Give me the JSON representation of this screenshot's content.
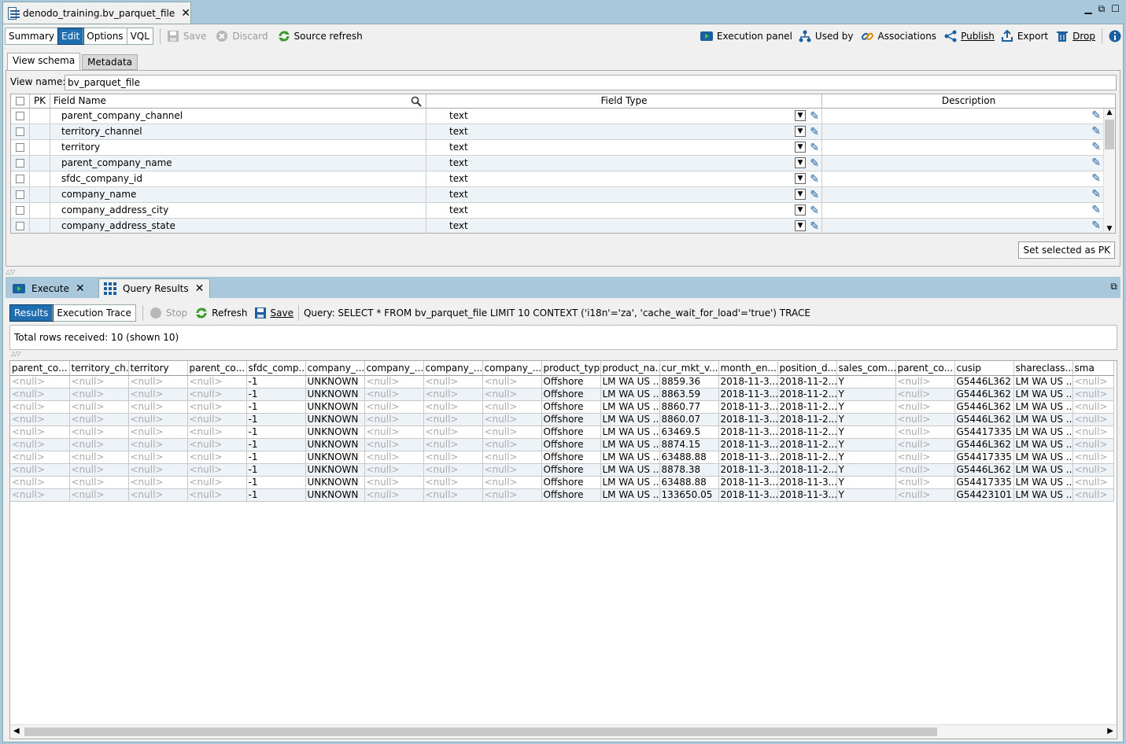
{
  "editor_tab": {
    "title": "denodo_training.bv_parquet_file"
  },
  "toolbar": {
    "modes": [
      "Summary",
      "Edit",
      "Options",
      "VQL"
    ],
    "active_mode": "Edit",
    "save_label": "Save",
    "discard_label": "Discard",
    "source_refresh_label": "Source refresh",
    "execution_panel_label": "Execution panel",
    "used_by_label": "Used by",
    "associations_label": "Associations",
    "publish_label": "Publish",
    "export_label": "Export",
    "drop_label": "Drop"
  },
  "subtabs": {
    "view_schema": "View schema",
    "metadata": "Metadata"
  },
  "view_name": {
    "label": "View name:",
    "value": "bv_parquet_file"
  },
  "schema": {
    "headers": {
      "pk": "PK",
      "field_name": "Field Name",
      "field_type": "Field Type",
      "description": "Description"
    },
    "rows": [
      {
        "name": "parent_company_channel",
        "type": "text"
      },
      {
        "name": "territory_channel",
        "type": "text"
      },
      {
        "name": "territory",
        "type": "text"
      },
      {
        "name": "parent_company_name",
        "type": "text"
      },
      {
        "name": "sfdc_company_id",
        "type": "text"
      },
      {
        "name": "company_name",
        "type": "text"
      },
      {
        "name": "company_address_city",
        "type": "text"
      },
      {
        "name": "company_address_state",
        "type": "text"
      }
    ],
    "set_pk_label": "Set selected as PK"
  },
  "bottom_tabs": {
    "execute": "Execute",
    "query_results": "Query Results"
  },
  "results_toolbar": {
    "results_label": "Results",
    "execution_trace_label": "Execution Trace",
    "stop_label": "Stop",
    "refresh_label": "Refresh",
    "save_label": "Save",
    "query": "Query: SELECT * FROM bv_parquet_file LIMIT 10 CONTEXT ('i18n'='za', 'cache_wait_for_load'='true') TRACE"
  },
  "total_rows": "Total rows received: 10 (shown 10)",
  "results": {
    "columns": [
      "parent_co...",
      "territory_ch...",
      "territory",
      "parent_co...",
      "sfdc_comp...",
      "company_...",
      "company_...",
      "company_...",
      "company_...",
      "product_type",
      "product_na...",
      "cur_mkt_v...",
      "month_en...",
      "position_d...",
      "sales_com...",
      "parent_co...",
      "cusip",
      "shareclass...",
      "sma"
    ],
    "rows": [
      [
        "<null>",
        "<null>",
        "<null>",
        "<null>",
        "-1",
        "UNKNOWN",
        "<null>",
        "<null>",
        "<null>",
        "Offshore",
        "LM WA US ...",
        "8859.36",
        "2018-11-3...",
        "2018-11-2...",
        "Y",
        "<null>",
        "G5446L362",
        "LM WA US ...",
        "<null>"
      ],
      [
        "<null>",
        "<null>",
        "<null>",
        "<null>",
        "-1",
        "UNKNOWN",
        "<null>",
        "<null>",
        "<null>",
        "Offshore",
        "LM WA US ...",
        "8863.59",
        "2018-11-3...",
        "2018-11-2...",
        "Y",
        "<null>",
        "G5446L362",
        "LM WA US ...",
        "<null>"
      ],
      [
        "<null>",
        "<null>",
        "<null>",
        "<null>",
        "-1",
        "UNKNOWN",
        "<null>",
        "<null>",
        "<null>",
        "Offshore",
        "LM WA US ...",
        "8860.77",
        "2018-11-3...",
        "2018-11-2...",
        "Y",
        "<null>",
        "G5446L362",
        "LM WA US ...",
        "<null>"
      ],
      [
        "<null>",
        "<null>",
        "<null>",
        "<null>",
        "-1",
        "UNKNOWN",
        "<null>",
        "<null>",
        "<null>",
        "Offshore",
        "LM WA US ...",
        "8860.07",
        "2018-11-3...",
        "2018-11-2...",
        "Y",
        "<null>",
        "G5446L362",
        "LM WA US ...",
        "<null>"
      ],
      [
        "<null>",
        "<null>",
        "<null>",
        "<null>",
        "-1",
        "UNKNOWN",
        "<null>",
        "<null>",
        "<null>",
        "Offshore",
        "LM WA US ...",
        "63469.5",
        "2018-11-3...",
        "2018-11-2...",
        "Y",
        "<null>",
        "G54417335",
        "LM WA US ...",
        "<null>"
      ],
      [
        "<null>",
        "<null>",
        "<null>",
        "<null>",
        "-1",
        "UNKNOWN",
        "<null>",
        "<null>",
        "<null>",
        "Offshore",
        "LM WA US ...",
        "8874.15",
        "2018-11-3...",
        "2018-11-2...",
        "Y",
        "<null>",
        "G5446L362",
        "LM WA US ...",
        "<null>"
      ],
      [
        "<null>",
        "<null>",
        "<null>",
        "<null>",
        "-1",
        "UNKNOWN",
        "<null>",
        "<null>",
        "<null>",
        "Offshore",
        "LM WA US ...",
        "63488.88",
        "2018-11-3...",
        "2018-11-2...",
        "Y",
        "<null>",
        "G54417335",
        "LM WA US ...",
        "<null>"
      ],
      [
        "<null>",
        "<null>",
        "<null>",
        "<null>",
        "-1",
        "UNKNOWN",
        "<null>",
        "<null>",
        "<null>",
        "Offshore",
        "LM WA US ...",
        "8878.38",
        "2018-11-3...",
        "2018-11-2...",
        "Y",
        "<null>",
        "G5446L362",
        "LM WA US ...",
        "<null>"
      ],
      [
        "<null>",
        "<null>",
        "<null>",
        "<null>",
        "-1",
        "UNKNOWN",
        "<null>",
        "<null>",
        "<null>",
        "Offshore",
        "LM WA US ...",
        "63488.88",
        "2018-11-3...",
        "2018-11-3...",
        "Y",
        "<null>",
        "G54417335",
        "LM WA US ...",
        "<null>"
      ],
      [
        "<null>",
        "<null>",
        "<null>",
        "<null>",
        "-1",
        "UNKNOWN",
        "<null>",
        "<null>",
        "<null>",
        "Offshore",
        "LM WA US ...",
        "133650.05",
        "2018-11-3...",
        "2018-11-3...",
        "Y",
        "<null>",
        "G54423101",
        "LM WA US ...",
        "<null>"
      ]
    ]
  }
}
